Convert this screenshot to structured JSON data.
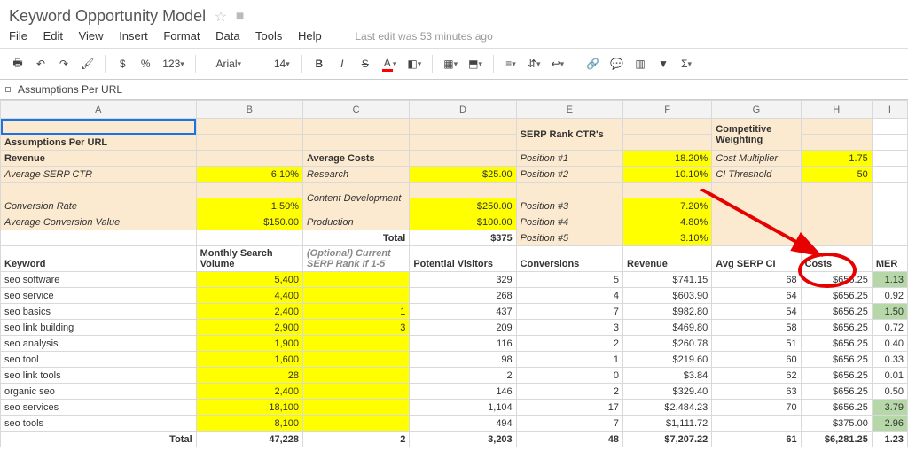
{
  "doc": {
    "title": "Keyword Opportunity Model"
  },
  "menus": [
    "File",
    "Edit",
    "View",
    "Insert",
    "Format",
    "Data",
    "Tools",
    "Help"
  ],
  "last_edit": "Last edit was 53 minutes ago",
  "toolbar": {
    "currency": "$",
    "percent": "%",
    "decimals": "123",
    "font": "Arial",
    "size": "14"
  },
  "formula_bar": "Assumptions Per URL",
  "columns": [
    "A",
    "B",
    "C",
    "D",
    "E",
    "F",
    "G",
    "H",
    "I"
  ],
  "assumptions": {
    "title": "Assumptions Per URL",
    "revenue_label": "Revenue",
    "avg_serp_ctr_label": "Average SERP CTR",
    "avg_serp_ctr_value": "6.10%",
    "conv_rate_label": "Conversion Rate",
    "conv_rate_value": "1.50%",
    "avg_conv_val_label": "Average Conversion Value",
    "avg_conv_val_value": "$150.00",
    "avg_costs_label": "Average Costs",
    "research_label": "Research",
    "research_value": "$25.00",
    "content_dev_label": "Content Development",
    "content_dev_value": "$250.00",
    "production_label": "Production",
    "production_value": "$100.00",
    "total_label": "Total",
    "total_value": "$375",
    "serp_rank_ctrs_label": "SERP Rank CTR's",
    "pos1_label": "Position #1",
    "pos1_value": "18.20%",
    "pos2_label": "Position #2",
    "pos2_value": "10.10%",
    "pos3_label": "Position #3",
    "pos3_value": "7.20%",
    "pos4_label": "Position #4",
    "pos4_value": "4.80%",
    "pos5_label": "Position #5",
    "pos5_value": "3.10%",
    "comp_weight_label": "Competitive Weighting",
    "cost_mult_label": "Cost Multiplier",
    "cost_mult_value": "1.75",
    "ci_thresh_label": "CI Threshold",
    "ci_thresh_value": "50"
  },
  "headers": {
    "keyword": "Keyword",
    "msv": "Monthly Search Volume",
    "opt_rank": "(Optional) Current SERP Rank If 1-5",
    "visitors": "Potential Visitors",
    "conversions": "Conversions",
    "revenue": "Revenue",
    "avg_ci": "Avg SERP CI",
    "costs": "Costs",
    "mer": "MER"
  },
  "rows": [
    {
      "k": "seo software",
      "msv": "5,400",
      "rank": "",
      "vis": "329",
      "conv": "5",
      "rev": "$741.15",
      "ci": "68",
      "cost": "$656.25",
      "mer": "1.13",
      "mer_hl": true
    },
    {
      "k": "seo service",
      "msv": "4,400",
      "rank": "",
      "vis": "268",
      "conv": "4",
      "rev": "$603.90",
      "ci": "64",
      "cost": "$656.25",
      "mer": "0.92"
    },
    {
      "k": "seo basics",
      "msv": "2,400",
      "rank": "1",
      "vis": "437",
      "conv": "7",
      "rev": "$982.80",
      "ci": "54",
      "cost": "$656.25",
      "mer": "1.50",
      "mer_hl": true
    },
    {
      "k": "seo link building",
      "msv": "2,900",
      "rank": "3",
      "vis": "209",
      "conv": "3",
      "rev": "$469.80",
      "ci": "58",
      "cost": "$656.25",
      "mer": "0.72"
    },
    {
      "k": "seo analysis",
      "msv": "1,900",
      "rank": "",
      "vis": "116",
      "conv": "2",
      "rev": "$260.78",
      "ci": "51",
      "cost": "$656.25",
      "mer": "0.40"
    },
    {
      "k": "seo tool",
      "msv": "1,600",
      "rank": "",
      "vis": "98",
      "conv": "1",
      "rev": "$219.60",
      "ci": "60",
      "cost": "$656.25",
      "mer": "0.33"
    },
    {
      "k": "seo link tools",
      "msv": "28",
      "rank": "",
      "vis": "2",
      "conv": "0",
      "rev": "$3.84",
      "ci": "62",
      "cost": "$656.25",
      "mer": "0.01"
    },
    {
      "k": "organic seo",
      "msv": "2,400",
      "rank": "",
      "vis": "146",
      "conv": "2",
      "rev": "$329.40",
      "ci": "63",
      "cost": "$656.25",
      "mer": "0.50"
    },
    {
      "k": "seo services",
      "msv": "18,100",
      "rank": "",
      "vis": "1,104",
      "conv": "17",
      "rev": "$2,484.23",
      "ci": "70",
      "cost": "$656.25",
      "mer": "3.79",
      "mer_hl": true
    },
    {
      "k": "seo tools",
      "msv": "8,100",
      "rank": "",
      "vis": "494",
      "conv": "7",
      "rev": "$1,111.72",
      "ci": "",
      "cost": "$375.00",
      "mer": "2.96",
      "mer_hl": true
    }
  ],
  "totals": {
    "label": "Total",
    "msv": "47,228",
    "rank": "2",
    "vis": "3,203",
    "conv": "48",
    "rev": "$7,207.22",
    "ci": "61",
    "cost": "$6,281.25",
    "mer": "1.23"
  }
}
